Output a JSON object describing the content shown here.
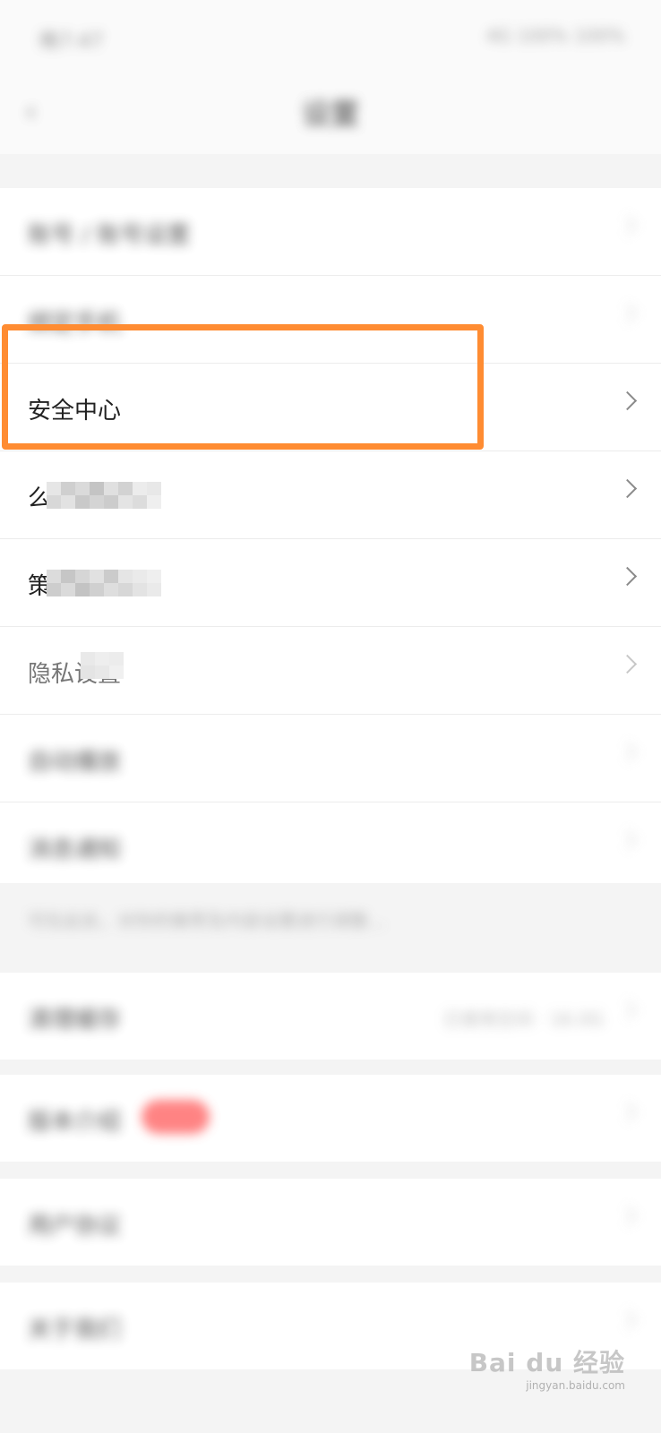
{
  "status_bar": {
    "time": "晚7:47",
    "right": "4G 100% 100%"
  },
  "header": {
    "back_icon": "back-arrow-icon",
    "title": "设置"
  },
  "groups": {
    "main": {
      "items": [
        {
          "label": "账号 / 账号设置"
        },
        {
          "label": "绑定手机"
        },
        {
          "label": "安全中心"
        },
        {
          "label": "么"
        },
        {
          "label": "策"
        },
        {
          "label": "隐私设置"
        },
        {
          "label": "自动播放"
        },
        {
          "label": "消息通知"
        }
      ]
    },
    "note": "可在此处，对你的推荐及内容设置进行调整..."
  },
  "group2": {
    "label": "清理缓存",
    "value": "已使用空间 · 16.0G"
  },
  "group3": {
    "label": "版本介绍"
  },
  "group4": {
    "label": "用户协议"
  },
  "group5": {
    "label": "关于我们"
  },
  "watermark": {
    "main": "Bai du 经验",
    "sub": "jingyan.baidu.com"
  },
  "colors": {
    "highlight": "#ff8c32",
    "badge": "#ff5a5a"
  }
}
